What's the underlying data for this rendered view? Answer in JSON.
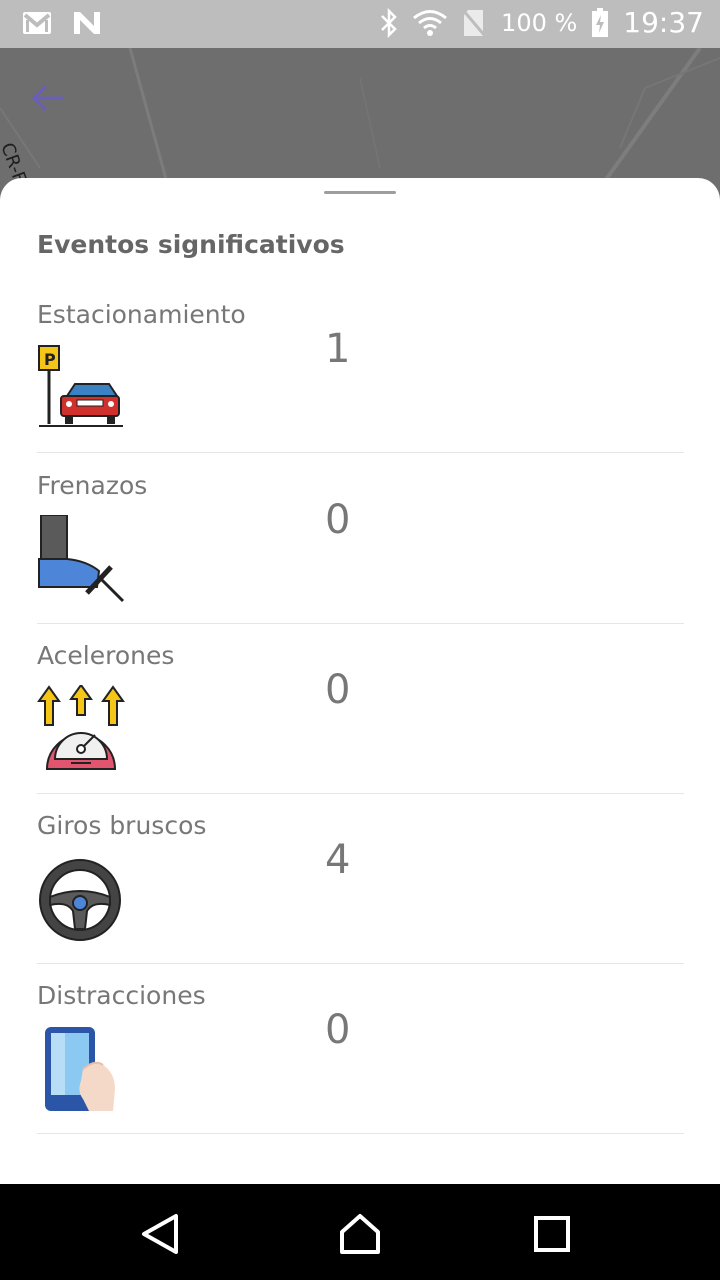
{
  "status_bar": {
    "battery": "100 %",
    "time": "19:37",
    "icons": [
      "gmail-icon",
      "n-app-icon",
      "bluetooth-icon",
      "wifi-icon",
      "no-sim-icon",
      "battery-charging-icon"
    ]
  },
  "map": {
    "road_label": "CR-F"
  },
  "sheet": {
    "title": "Eventos significativos",
    "events": [
      {
        "label": "Estacionamiento",
        "value": "1",
        "icon": "parking-car-icon"
      },
      {
        "label": "Frenazos",
        "value": "0",
        "icon": "brake-pedal-icon"
      },
      {
        "label": "Acelerones",
        "value": "0",
        "icon": "speedometer-arrows-icon"
      },
      {
        "label": "Giros bruscos",
        "value": "4",
        "icon": "steering-wheel-icon"
      },
      {
        "label": "Distracciones",
        "value": "0",
        "icon": "phone-hand-icon"
      }
    ]
  },
  "nav": {
    "icons": [
      "back-triangle-icon",
      "home-icon",
      "recents-square-icon"
    ]
  }
}
